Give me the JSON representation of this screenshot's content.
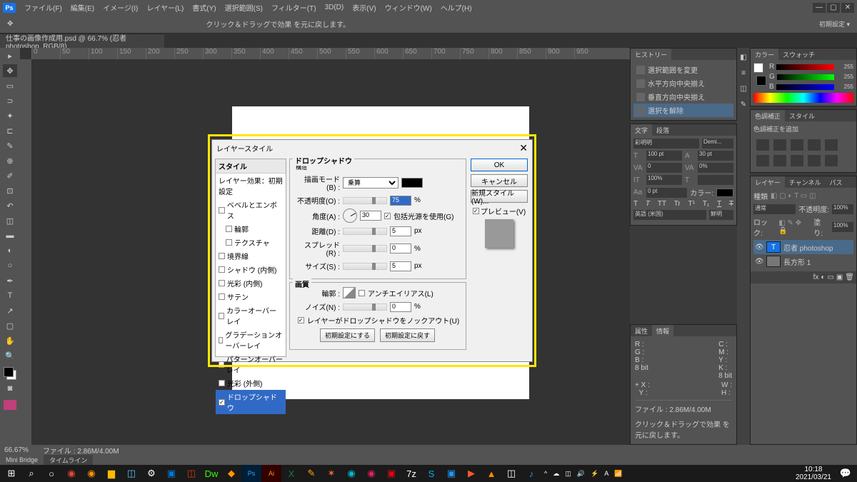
{
  "menus": {
    "file": "ファイル(F)",
    "edit": "編集(E)",
    "image": "イメージ(I)",
    "layer": "レイヤー(L)",
    "type": "書式(Y)",
    "select": "選択範囲(S)",
    "filter": "フィルター(T)",
    "three_d": "3D(D)",
    "view": "表示(V)",
    "window": "ウィンドウ(W)",
    "help": "ヘルプ(H)"
  },
  "options_bar": {
    "hint": "クリック＆ドラッグで効果 を元に戻します。",
    "right": "初期設定 ▾"
  },
  "doc_tab": "仕事の画像作成用.psd @ 66.7% (忍者photoshop, RGB/8)",
  "ruler": [
    "0",
    "50",
    "100",
    "150",
    "200",
    "250",
    "300",
    "350",
    "400",
    "450",
    "500",
    "550",
    "600",
    "650",
    "700",
    "750",
    "800",
    "850",
    "900",
    "950"
  ],
  "status": {
    "zoom": "66.67%",
    "file": "ファイル : 2.86M/4.00M"
  },
  "bottom_tabs": {
    "mini": "Mini Bridge",
    "timeline": "タイムライン"
  },
  "history": {
    "tab": "ヒストリー",
    "items": [
      "選択範囲を変更",
      "水平方向中央揃え",
      "垂直方向中央揃え",
      "選択を解除"
    ]
  },
  "char": {
    "tab1": "文字",
    "tab2": "段落",
    "font": "彩明明",
    "style": "Demi...",
    "size": "100 pt",
    "leading": "30 pt",
    "tracking": "0",
    "kerning": "0%",
    "vscale": "100%",
    "vshift": "0 pt",
    "color_lbl": "カラー:",
    "lang": "英語 (米国)",
    "aa": "鮮明"
  },
  "info": {
    "tab1": "属性",
    "tab2": "情報",
    "r": "R :",
    "g": "G :",
    "b": "B :",
    "bit": "8 bit",
    "c": "C :",
    "m": "M :",
    "y": "Y :",
    "k": "K :",
    "bit2": "8 bit",
    "xy": "X :\nY :",
    "wh": "W :\nH :",
    "file": "ファイル : 2.86M/4.00M",
    "hint": "クリック＆ドラッグで効果 を元に戻します。"
  },
  "color": {
    "tab1": "カラー",
    "tab2": "スウォッチ",
    "r": "R",
    "g": "G",
    "b": "B",
    "val": "255"
  },
  "adjust": {
    "tab1": "色調補正",
    "tab2": "スタイル",
    "hint": "色調補正を追加"
  },
  "layers": {
    "tab1": "レイヤー",
    "tab2": "チャンネル",
    "tab3": "パス",
    "kind": "種類",
    "mode": "通常",
    "opacity_lbl": "不透明度:",
    "opacity": "100%",
    "lock": "ロック:",
    "fill_lbl": "塗り:",
    "fill": "100%",
    "l1": "忍者 photoshop",
    "l2": "長方形 1"
  },
  "dialog": {
    "title": "レイヤースタイル",
    "styles_hdr": "スタイル",
    "blend_hdr": "レイヤー効果：初期設定",
    "styles": [
      "ベベルとエンボス",
      "輪郭",
      "テクスチャ",
      "境界線",
      "シャドウ (内側)",
      "光彩 (内側)",
      "サテン",
      "カラーオーバーレイ",
      "グラデーションオーバーレイ",
      "パターンオーバーレイ",
      "光彩 (外側)",
      "ドロップシャドウ"
    ],
    "group1": "ドロップシャドウ",
    "sub1": "構造",
    "blend_mode_lbl": "描画モード(B) :",
    "blend_mode": "乗算",
    "opacity_lbl": "不透明度(O) :",
    "opacity": "75",
    "pct": "%",
    "angle_lbl": "角度(A) :",
    "angle": "30",
    "global": "包括光源を使用(G)",
    "dist_lbl": "距離(D) :",
    "dist": "5",
    "px": "px",
    "spread_lbl": "スプレッド(R) :",
    "spread": "0",
    "size_lbl": "サイズ(S) :",
    "size": "5",
    "group2": "画質",
    "contour_lbl": "輪郭 :",
    "anti": "アンチエイリアス(L)",
    "noise_lbl": "ノイズ(N) :",
    "noise": "0",
    "knockout": "レイヤーがドロップシャドウをノックアウト(U)",
    "reset_def": "初期設定にする",
    "reset": "初期設定に戻す",
    "ok": "OK",
    "cancel": "キャンセル",
    "new_style": "新規スタイル(W)...",
    "preview": "プレビュー(V)"
  },
  "taskbar": {
    "time": "10:18",
    "date": "2021/03/21"
  }
}
